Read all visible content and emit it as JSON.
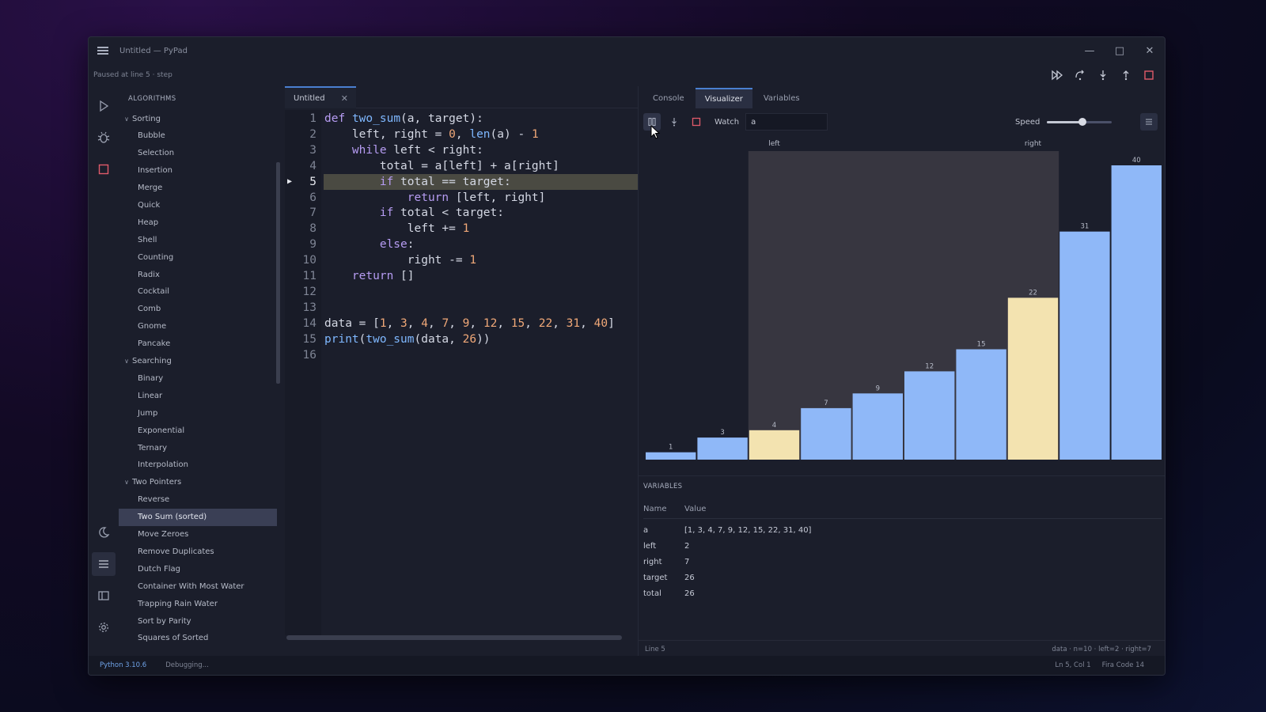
{
  "window": {
    "title": "Untitled — PyPad",
    "status_text": "Paused at line 5 · step"
  },
  "sidebar": {
    "header": "ALGORITHMS",
    "groups": [
      {
        "label": "Sorting",
        "items": [
          "Bubble",
          "Selection",
          "Insertion",
          "Merge",
          "Quick",
          "Heap",
          "Shell",
          "Counting",
          "Radix",
          "Cocktail",
          "Comb",
          "Gnome",
          "Pancake"
        ]
      },
      {
        "label": "Searching",
        "items": [
          "Binary",
          "Linear",
          "Jump",
          "Exponential",
          "Ternary",
          "Interpolation"
        ]
      },
      {
        "label": "Two Pointers",
        "items": [
          "Reverse",
          "Two Sum (sorted)",
          "Move Zeroes",
          "Remove Duplicates",
          "Dutch Flag",
          "Container With Most Water",
          "Trapping Rain Water",
          "Sort by Parity",
          "Squares of Sorted"
        ]
      }
    ],
    "selected": "Two Sum (sorted)"
  },
  "editor": {
    "tab_label": "Untitled",
    "current_line": 5,
    "lines": [
      "def two_sum(a, target):",
      "    left, right = 0, len(a) - 1",
      "    while left < right:",
      "        total = a[left] + a[right]",
      "        if total == target:",
      "            return [left, right]",
      "        if total < target:",
      "            left += 1",
      "        else:",
      "            right -= 1",
      "    return []",
      "",
      "",
      "data = [1, 3, 4, 7, 9, 12, 15, 22, 31, 40]",
      "print(two_sum(data, 26))",
      ""
    ]
  },
  "panel": {
    "tabs": [
      "Console",
      "Visualizer",
      "Variables"
    ],
    "active_tab": "Visualizer",
    "watch_label": "Watch",
    "watch_value": "a",
    "speed_label": "Speed",
    "speed_value": 0.55
  },
  "chart_data": {
    "type": "bar",
    "values": [
      1,
      3,
      4,
      7,
      9,
      12,
      15,
      22,
      31,
      40
    ],
    "highlighted_indices": [
      2,
      7
    ],
    "pointer_labels": {
      "left": "left",
      "right": "right"
    },
    "window_range": [
      2,
      7
    ],
    "ylim": [
      0,
      40
    ],
    "colors": {
      "bar": "#8fb8f8",
      "highlight": "#f3e3b0",
      "window": "#373640",
      "label": "#b6bbc8"
    }
  },
  "variables": {
    "header": "VARIABLES",
    "col_name": "Name",
    "col_value": "Value",
    "rows": [
      {
        "name": "a",
        "value": "[1, 3, 4, 7, 9, 12, 15, 22, 31, 40]"
      },
      {
        "name": "left",
        "value": "2"
      },
      {
        "name": "right",
        "value": "7"
      },
      {
        "name": "target",
        "value": "26"
      },
      {
        "name": "total",
        "value": "26"
      }
    ]
  },
  "panel_status": {
    "left": "Line 5",
    "right": "data · n=10 · left=2 · right=7"
  },
  "statusbar": {
    "python": "Python 3.10.6",
    "state": "Debugging...",
    "position": "Ln 5, Col 1",
    "font": "Fira Code 14"
  }
}
